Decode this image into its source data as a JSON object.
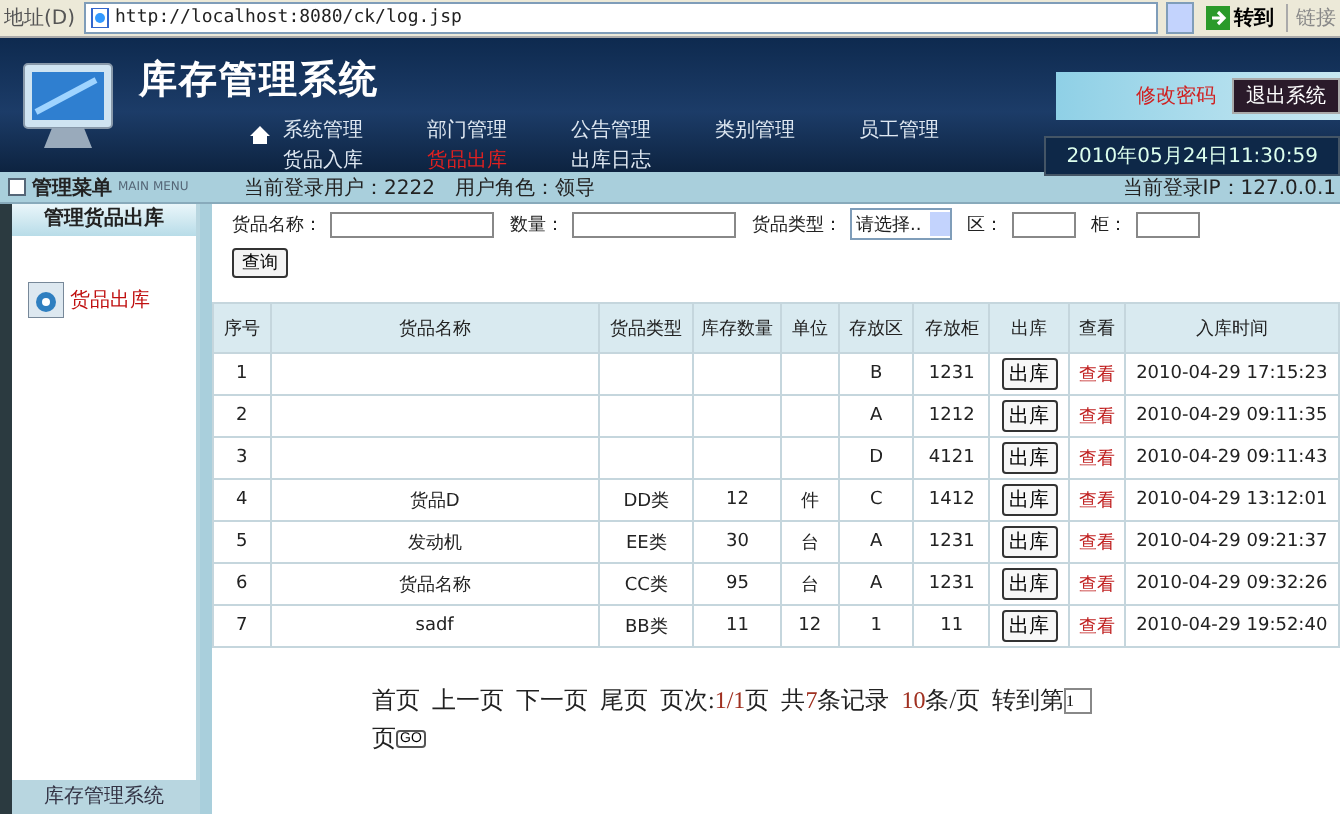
{
  "address_bar": {
    "label": "地址(D)",
    "url": "http://localhost:8080/ck/log.jsp",
    "go": "转到",
    "links": "链接"
  },
  "header": {
    "title": "库存管理系统",
    "change_password": "修改密码",
    "logout": "退出系统",
    "datetime": "2010年05月24日11:30:59",
    "nav": [
      {
        "label": "系统管理",
        "selected": false
      },
      {
        "label": "部门管理",
        "selected": false
      },
      {
        "label": "公告管理",
        "selected": false
      },
      {
        "label": "类别管理",
        "selected": false
      },
      {
        "label": "员工管理",
        "selected": false
      },
      {
        "label": "货品入库",
        "selected": false
      },
      {
        "label": "货品出库",
        "selected": true
      },
      {
        "label": "出库日志",
        "selected": false
      }
    ]
  },
  "info_bar": {
    "menu_title": "管理菜单",
    "menu_subtitle": "MAIN MENU",
    "user": "当前登录用户：2222",
    "role": "用户角色：领导",
    "ip": "当前登录IP：127.0.0.1"
  },
  "sidebar": {
    "title": "管理货品出库",
    "items": [
      {
        "label": "货品出库",
        "selected": true
      }
    ],
    "footer": "库存管理系统"
  },
  "search": {
    "fields": [
      {
        "label": "货品名称：",
        "kind": "text"
      },
      {
        "label": "数量：",
        "kind": "text"
      },
      {
        "label": "货品类型：",
        "kind": "select",
        "value": "请选择.."
      },
      {
        "label": "区：",
        "kind": "text"
      },
      {
        "label": "柜：",
        "kind": "text"
      }
    ],
    "button": "查询"
  },
  "table": {
    "columns": [
      "序号",
      "货品名称",
      "货品类型",
      "库存数量",
      "单位",
      "存放区",
      "存放柜",
      "出库",
      "查看",
      "入库时间"
    ],
    "rows": [
      {
        "no": "1",
        "area": "B",
        "cabinet": "1231",
        "action": "出库",
        "view": "查看",
        "time": "2010-04-29 17:15:23"
      },
      {
        "no": "2",
        "area": "A",
        "cabinet": "1212",
        "action": "出库",
        "view": "查看",
        "time": "2010-04-29 09:11:35"
      },
      {
        "no": "3",
        "area": "D",
        "cabinet": "4121",
        "action": "出库",
        "view": "查看",
        "time": "2010-04-29 09:11:43"
      },
      {
        "no": "4",
        "name": "货品D",
        "type": "DD类",
        "qty": "12",
        "unit": "件",
        "area": "C",
        "cabinet": "1412",
        "action": "出库",
        "view": "查看",
        "time": "2010-04-29 13:12:01"
      },
      {
        "no": "5",
        "name": "发动机",
        "type": "EE类",
        "qty": "30",
        "unit": "台",
        "area": "A",
        "cabinet": "1231",
        "action": "出库",
        "view": "查看",
        "time": "2010-04-29 09:21:37"
      },
      {
        "no": "6",
        "name": "货品名称",
        "type": "CC类",
        "qty": "95",
        "unit": "台",
        "area": "A",
        "cabinet": "1231",
        "action": "出库",
        "view": "查看",
        "time": "2010-04-29 09:32:26"
      },
      {
        "no": "7",
        "name": "sadf",
        "type": "BB类",
        "qty": "11",
        "unit": "12",
        "area": "1",
        "cabinet": "11",
        "action": "出库",
        "view": "查看",
        "time": "2010-04-29 19:52:40"
      }
    ]
  },
  "pager": {
    "links": [
      "首页",
      "上一页",
      "下一页",
      "尾页"
    ],
    "page_label": "页次:",
    "page_value": "1/1",
    "page_suffix": "页",
    "total_prefix": "共",
    "total": "7",
    "total_suffix": "条记录",
    "per_page": "10",
    "per_page_suffix": "条/页",
    "goto_prefix": "转到第",
    "goto_value": "1",
    "goto_suffix": "页",
    "go": "GO"
  }
}
